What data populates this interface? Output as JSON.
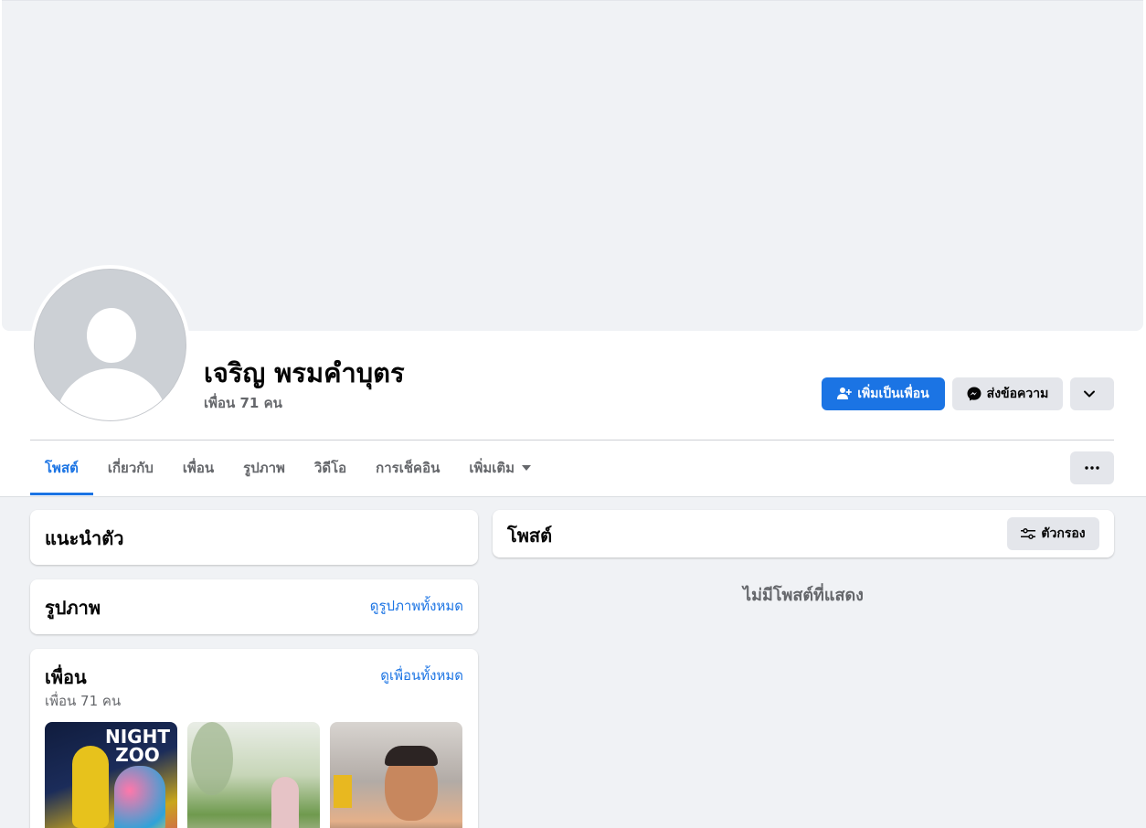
{
  "profile": {
    "name": "เจริญ พรมคำบุตร",
    "friend_count": "เพื่อน 71 คน"
  },
  "actions": {
    "add_friend": "เพิ่มเป็นเพื่อน",
    "message": "ส่งข้อความ"
  },
  "tabs": [
    {
      "label": "โพสต์",
      "active": true
    },
    {
      "label": "เกี่ยวกับ"
    },
    {
      "label": "เพื่อน"
    },
    {
      "label": "รูปภาพ"
    },
    {
      "label": "วิดีโอ"
    },
    {
      "label": "การเช็คอิน"
    },
    {
      "label": "เพิ่มเติม"
    }
  ],
  "intro": {
    "title": "แนะนำตัว"
  },
  "photos": {
    "title": "รูปภาพ",
    "see_all": "ดูรูปภาพทั้งหมด"
  },
  "friends": {
    "title": "เพื่อน",
    "see_all": "ดูเพื่อนทั้งหมด",
    "count": "เพื่อน 71 คน",
    "photo1_text": "NIGHT ZOO"
  },
  "posts": {
    "title": "โพสต์",
    "filter": "ตัวกรอง",
    "empty": "ไม่มีโพสต์ที่แสดง"
  },
  "colors": {
    "accent": "#1b74e4",
    "background": "#f0f2f5",
    "secondary_text": "#65676b",
    "button_gray": "#e4e6eb"
  },
  "icons": {
    "add_friend": "add-person-icon",
    "message": "messenger-icon",
    "dropdown": "chevron-down-icon",
    "more": "ellipsis-icon",
    "filter": "sliders-icon"
  }
}
